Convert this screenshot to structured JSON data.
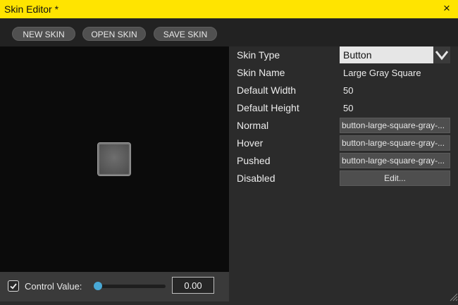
{
  "window": {
    "title": "Skin Editor *",
    "close_icon": "×"
  },
  "toolbar": {
    "new_skin": "NEW SKIN",
    "open_skin": "OPEN SKIN",
    "save_skin": "SAVE SKIN"
  },
  "control": {
    "checked": true,
    "label": "Control Value:",
    "slider_value": 0.0,
    "value_text": "0.00"
  },
  "properties": {
    "skin_type_label": "Skin Type",
    "skin_type_value": "Button",
    "skin_name_label": "Skin Name",
    "skin_name_value": "Large Gray Square",
    "default_width_label": "Default Width",
    "default_width_value": "50",
    "default_height_label": "Default Height",
    "default_height_value": "50",
    "normal_label": "Normal",
    "normal_value": "button-large-square-gray-...",
    "hover_label": "Hover",
    "hover_value": "button-large-square-gray-...",
    "pushed_label": "Pushed",
    "pushed_value": "button-large-square-gray-...",
    "disabled_label": "Disabled",
    "disabled_value": "Edit..."
  },
  "colors": {
    "titlebar": "#ffe400",
    "slider_accent": "#45a5d0"
  }
}
